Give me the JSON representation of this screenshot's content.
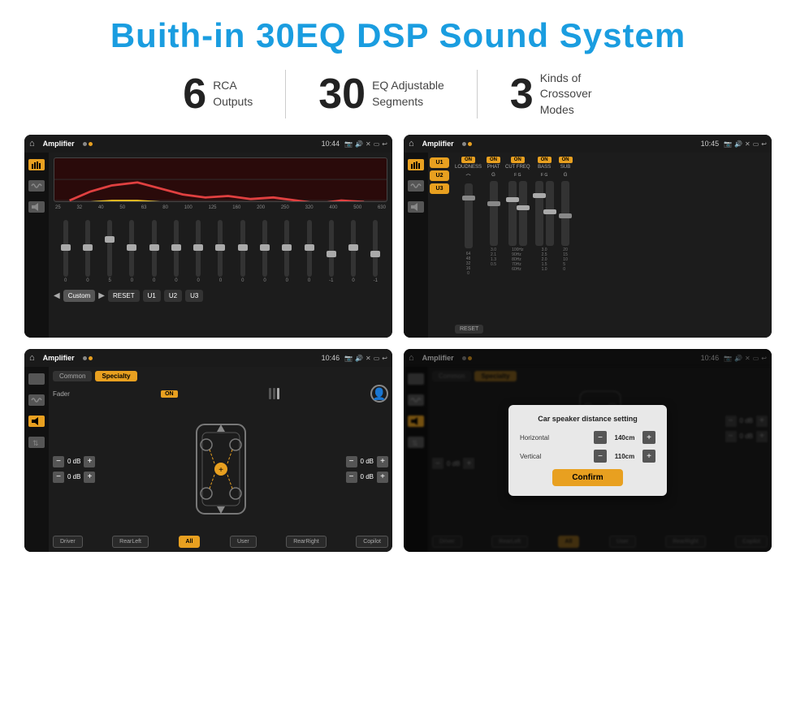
{
  "header": {
    "title": "Buith-in 30EQ DSP Sound System"
  },
  "stats": [
    {
      "number": "6",
      "label_line1": "RCA",
      "label_line2": "Outputs"
    },
    {
      "number": "30",
      "label_line1": "EQ Adjustable",
      "label_line2": "Segments"
    },
    {
      "number": "3",
      "label_line1": "Kinds of",
      "label_line2": "Crossover Modes"
    }
  ],
  "screen1": {
    "topbar": {
      "title": "Amplifier",
      "time": "10:44"
    },
    "eq_labels": [
      "25",
      "32",
      "40",
      "50",
      "63",
      "80",
      "100",
      "125",
      "160",
      "200",
      "250",
      "320",
      "400",
      "500",
      "630"
    ],
    "eq_values": [
      "0",
      "0",
      "0",
      "5",
      "0",
      "0",
      "0",
      "0",
      "0",
      "0",
      "0",
      "0",
      "-1",
      "0",
      "-1"
    ],
    "buttons": [
      "Custom",
      "RESET",
      "U1",
      "U2",
      "U3"
    ]
  },
  "screen2": {
    "topbar": {
      "title": "Amplifier",
      "time": "10:45"
    },
    "presets": [
      "U1",
      "U2",
      "U3"
    ],
    "channels": [
      "LOUDNESS",
      "PHAT",
      "CUT FREQ",
      "BASS",
      "SUB"
    ],
    "reset_label": "RESET"
  },
  "screen3": {
    "topbar": {
      "title": "Amplifier",
      "time": "10:46"
    },
    "tabs": [
      "Common",
      "Specialty"
    ],
    "fader_label": "Fader",
    "db_values": [
      "0 dB",
      "0 dB",
      "0 dB",
      "0 dB"
    ],
    "bottom_buttons": [
      "Driver",
      "RearLeft",
      "All",
      "User",
      "RearRight",
      "Copilot"
    ]
  },
  "screen4": {
    "topbar": {
      "title": "Amplifier",
      "time": "10:46"
    },
    "tabs": [
      "Common",
      "Specialty"
    ],
    "dialog": {
      "title": "Car speaker distance setting",
      "horizontal_label": "Horizontal",
      "horizontal_value": "140cm",
      "vertical_label": "Vertical",
      "vertical_value": "110cm",
      "confirm_label": "Confirm"
    },
    "db_values": [
      "0 dB",
      "0 dB"
    ],
    "bottom_buttons": [
      "Driver",
      "RearLeft",
      "All",
      "User",
      "RearRight",
      "Copilot"
    ]
  }
}
